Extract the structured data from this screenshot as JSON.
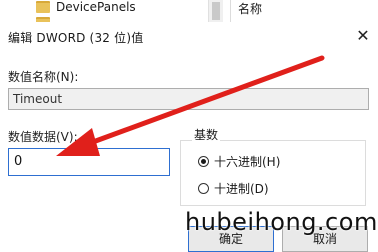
{
  "background": {
    "tree_item": "DevicePanels",
    "column_header": "名称"
  },
  "dialog": {
    "title": "编辑 DWORD (32 位)值",
    "close_glyph": "✕",
    "value_name_label": "数值名称(N):",
    "value_name": "Timeout",
    "value_data_label": "数值数据(V):",
    "value_data": "0",
    "base_group_label": "基数",
    "radio_hex": "十六进制(H)",
    "radio_dec": "十进制(D)",
    "selected_base": "hex",
    "ok_label": "确定",
    "cancel_label": "取消"
  },
  "annotation": {
    "arrow_color": "#e0201b"
  },
  "watermark": "hubeihong.com"
}
